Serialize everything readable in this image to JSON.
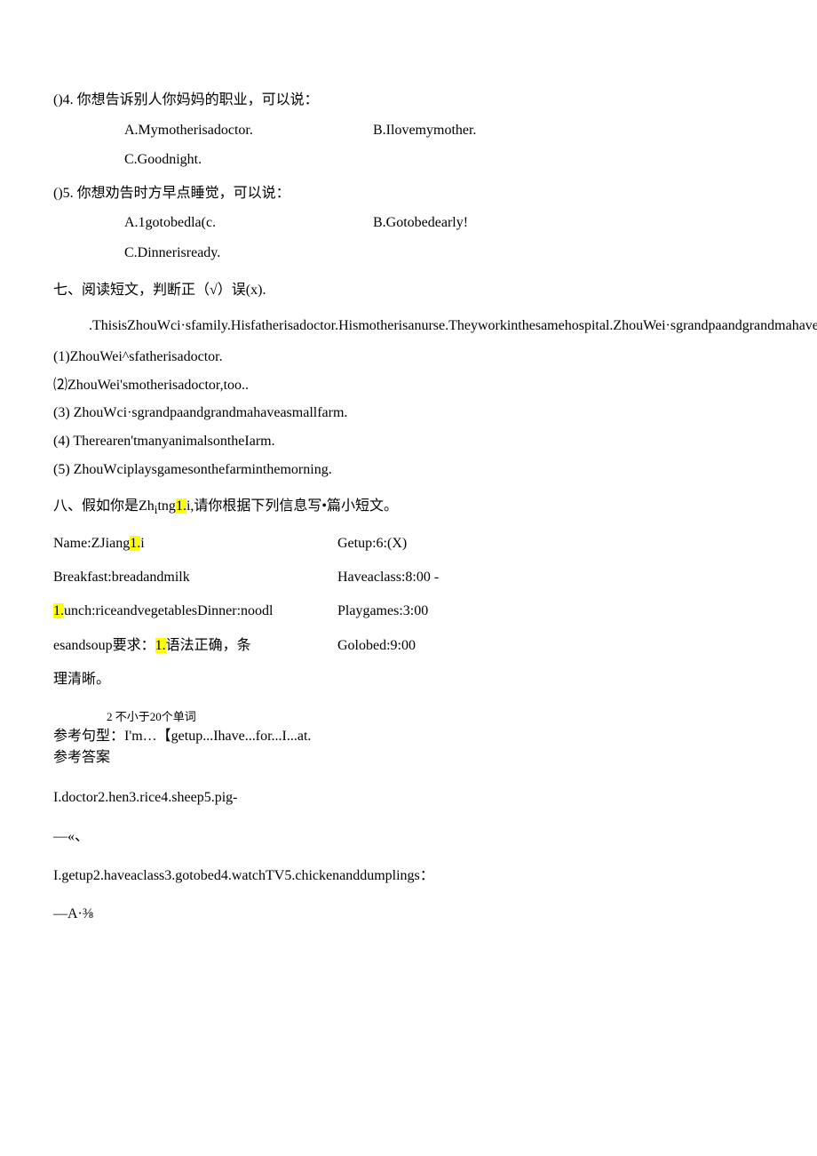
{
  "q4": {
    "header": "()4. 你想告诉别人你妈妈的职业，可以说：",
    "optA": "A.Mymotherisadoctor.",
    "optB": "B.Ilovemymother.",
    "optC": "C.Goodnight."
  },
  "q5": {
    "header": "()5. 你想劝告时方早点睡觉，可以说：",
    "optA": "A.1gotobedla(c.",
    "optB": "B.Gotobedearly!",
    "optC": "C.Dinnerisready."
  },
  "section7": {
    "title": "七、阅读短文，判断正（√）误(x).",
    "passage1": ".ThisisZhouWci·sfamily.Hisfatherisadoctor.Hismotherisanurse.Theyworkinthesamehospital.ZhouWei·sgrandpaandgrandmahaveabigfarm,!\"herearemanyanimalsonthefarm.ZhouWeiplaysgamesonthefarmintheafternoon.Hclikesthefarm.",
    "item1": "(1)ZhouWei^sfatherisadoctor.",
    "item2": "⑵ZhouWei'smotherisadoctor,too..",
    "item3": "(3)    ZhouWci·sgrandpaandgrandmahaveasmallfarm.",
    "item4": "(4)    Therearen'tmanyanimalsontheIarm.",
    "item5": "(5)    ZhouWciplaysgamesonthefarminthemorning."
  },
  "section8": {
    "title_pre": "八、假如你是Zh",
    "title_sub": "i",
    "title_mid": "tng",
    "title_hl": "1.",
    "title_post": "i,请你根据下列信息写•篇小短文。",
    "left": {
      "name_pre": "Name:ZJiang",
      "name_hl": "1.",
      "name_post": "i",
      "breakfast": "Breakfast:breadandmilk",
      "lunch_hl": "1.",
      "lunch": "unch:riceandvegetablesDinner:noodl",
      "req_pre": "esandsoup要求：",
      "req_hl": "1.",
      "req_post": "语法正确，条",
      "req_line2": "理清晰。"
    },
    "right": {
      "getup": "Getup:6:(X)",
      "haveclass": "Haveaclass:8:00                -",
      "playgames": "Playgames:3:00",
      "gotobed": "Golobed:9:00"
    },
    "cut": "2 不小于20个单词",
    "ref1": "参考句型：I'm…【getup...Ihave...for...I...at.",
    "ref2": "参考答案"
  },
  "answers": {
    "line1": "I.doctor2.hen3.rice4.sheep5.pig-",
    "line2": "—«、",
    "line3": "I.getup2.haveaclass3.gotobed4.watchTV5.chickenanddumplings：",
    "line4": "—A·⅜"
  }
}
